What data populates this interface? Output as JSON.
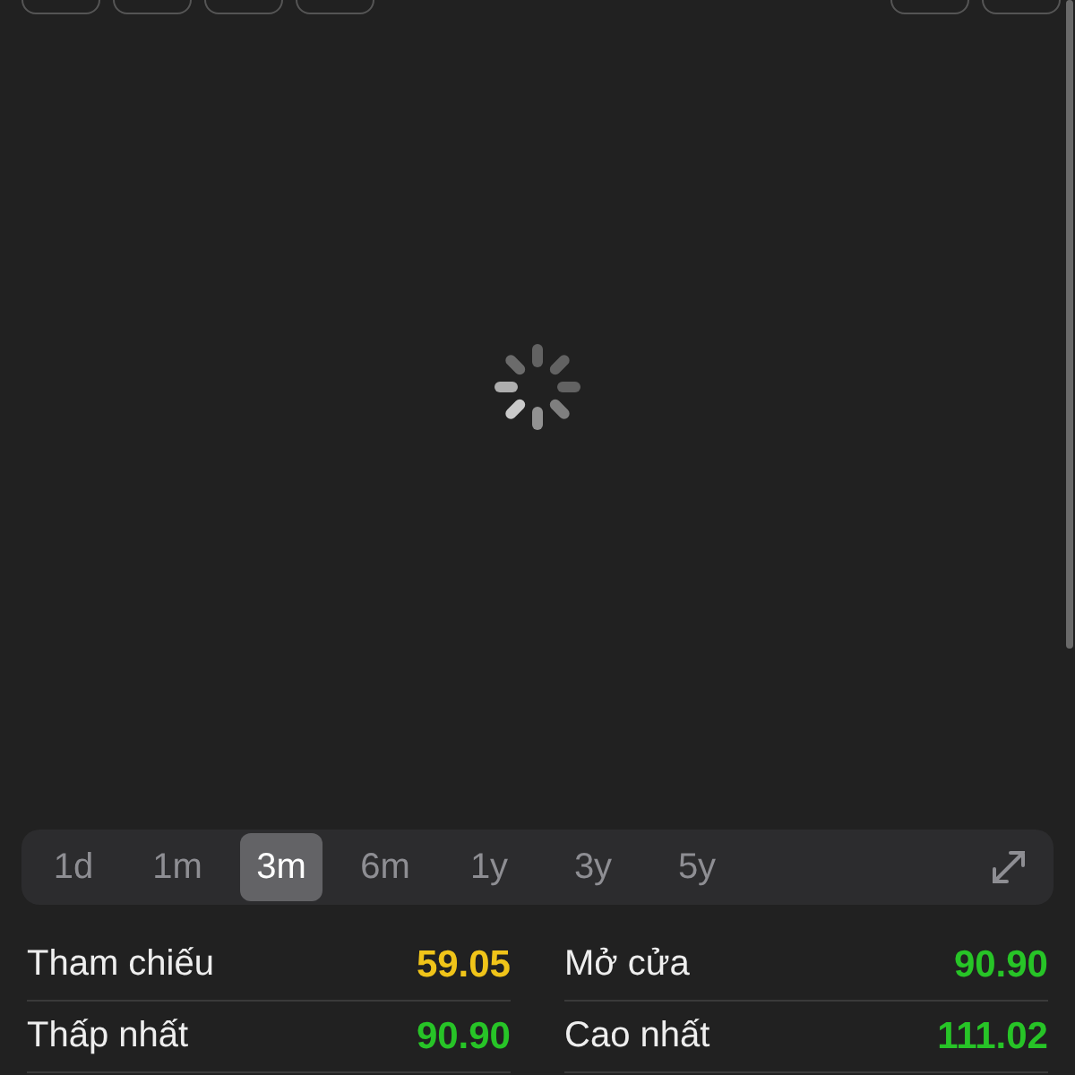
{
  "loading": true,
  "periods": [
    {
      "label": "1d",
      "selected": false
    },
    {
      "label": "1m",
      "selected": false
    },
    {
      "label": "3m",
      "selected": true
    },
    {
      "label": "6m",
      "selected": false
    },
    {
      "label": "1y",
      "selected": false
    },
    {
      "label": "3y",
      "selected": false
    },
    {
      "label": "5y",
      "selected": false
    }
  ],
  "stats": [
    {
      "label": "Tham chiếu",
      "value": "59.05",
      "color": "#f0c419"
    },
    {
      "label": "Mở cửa",
      "value": "90.90",
      "color": "#27c427"
    },
    {
      "label": "Thấp nhất",
      "value": "90.90",
      "color": "#27c427"
    },
    {
      "label": "Cao nhất",
      "value": "111.02",
      "color": "#27c427"
    }
  ]
}
